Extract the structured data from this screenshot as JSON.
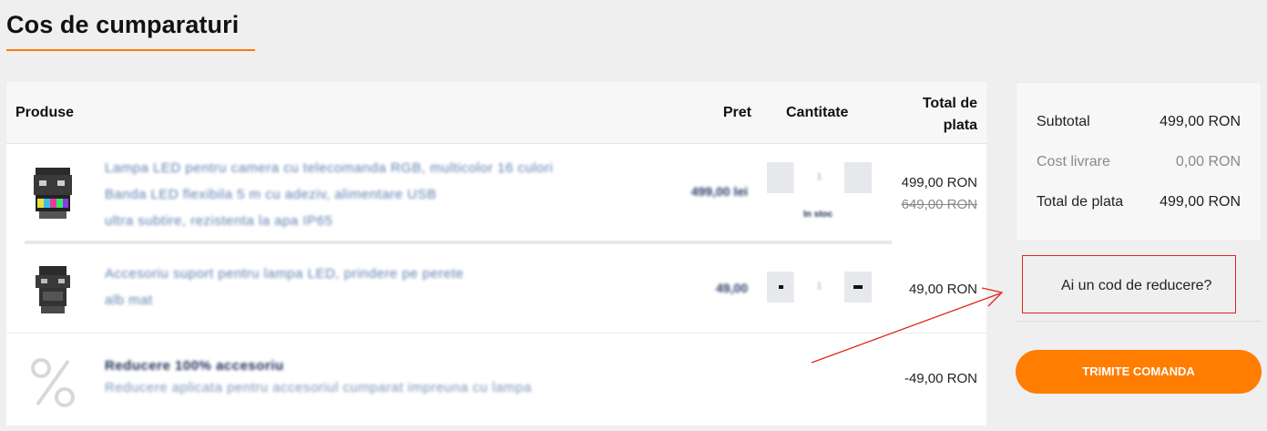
{
  "page": {
    "title": "Cos de cumparaturi"
  },
  "table": {
    "headers": {
      "products": "Produse",
      "price": "Pret",
      "quantity": "Cantitate",
      "total_line1": "Total de",
      "total_line2": "plata"
    },
    "rows": [
      {
        "description_line1": "Lampa LED pentru camera cu telecomanda RGB, multicolor 16 culori",
        "description_line2": "Banda LED flexibila 5 m cu adeziv, alimentare USB",
        "description_line3": "ultra subtire, rezistenta la apa IP65",
        "unit_price": "499,00 lei",
        "quantity": "1",
        "stock_note": "In stoc",
        "total": "499,00 RON",
        "old_total": "649,00 RON"
      },
      {
        "description_line1": "Accesoriu suport pentru lampa LED, prindere pe perete",
        "description_line2": "alb mat",
        "unit_price": "49,00",
        "quantity": "1",
        "total": "49,00 RON"
      },
      {
        "description_strong": "Reducere 100% accesoriu",
        "description_line2": "Reducere aplicata pentru accesoriul cumparat impreuna cu lampa",
        "total": "-49,00 RON"
      }
    ]
  },
  "summary": {
    "subtotal_label": "Subtotal",
    "subtotal_value": "499,00 RON",
    "shipping_label": "Cost livrare",
    "shipping_value": "0,00 RON",
    "total_label": "Total de plata",
    "total_value": "499,00 RON"
  },
  "coupon": {
    "link_label": "Ai un cod de reducere?"
  },
  "actions": {
    "submit_label": "TRIMITE COMANDA"
  },
  "colors": {
    "accent": "#ff7d00",
    "annotation": "#e1251b",
    "link": "#5d7fb0"
  },
  "icons": {
    "row1_thumb": "product-image",
    "row2_thumb": "product-image",
    "row3_thumb": "percent-discount-icon"
  }
}
